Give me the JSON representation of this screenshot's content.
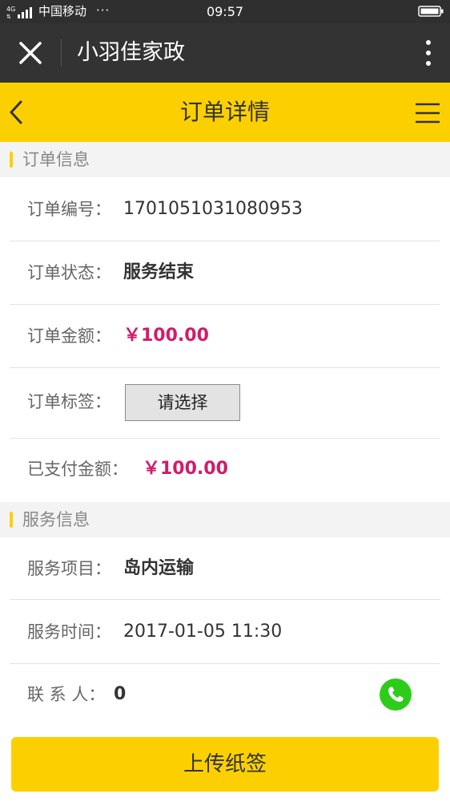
{
  "status_bar": {
    "network": "4G",
    "carrier": "中国移动",
    "more": "···",
    "time": "09:57"
  },
  "wechat_bar": {
    "title": "小羽佳家政",
    "close_icon": "close-icon",
    "more_icon": "more-vertical-icon"
  },
  "header": {
    "title": "订单详情",
    "back_icon": "chevron-left-icon",
    "menu_icon": "hamburger-menu-icon",
    "accent_color": "#fcd000"
  },
  "order_section": {
    "title": "订单信息",
    "order_no_label": "订单编号：",
    "order_no": "1701051031080953",
    "status_label": "订单状态：",
    "status": "服务结束",
    "amount_label": "订单金额：",
    "amount": "￥100.00",
    "tag_label": "订单标签：",
    "tag_select": "请选择",
    "paid_label": "已支付金额：",
    "paid": "￥100.00",
    "money_color": "#d11b6a"
  },
  "service_section": {
    "title": "服务信息",
    "item_label": "服务项目：",
    "item": "岛内运输",
    "time_label": "服务时间：",
    "time": "2017-01-05 11:30",
    "contact_label": "联 系 人：",
    "contact": "0",
    "phone_icon": "phone-icon"
  },
  "footer": {
    "upload_label": "上传纸签"
  }
}
